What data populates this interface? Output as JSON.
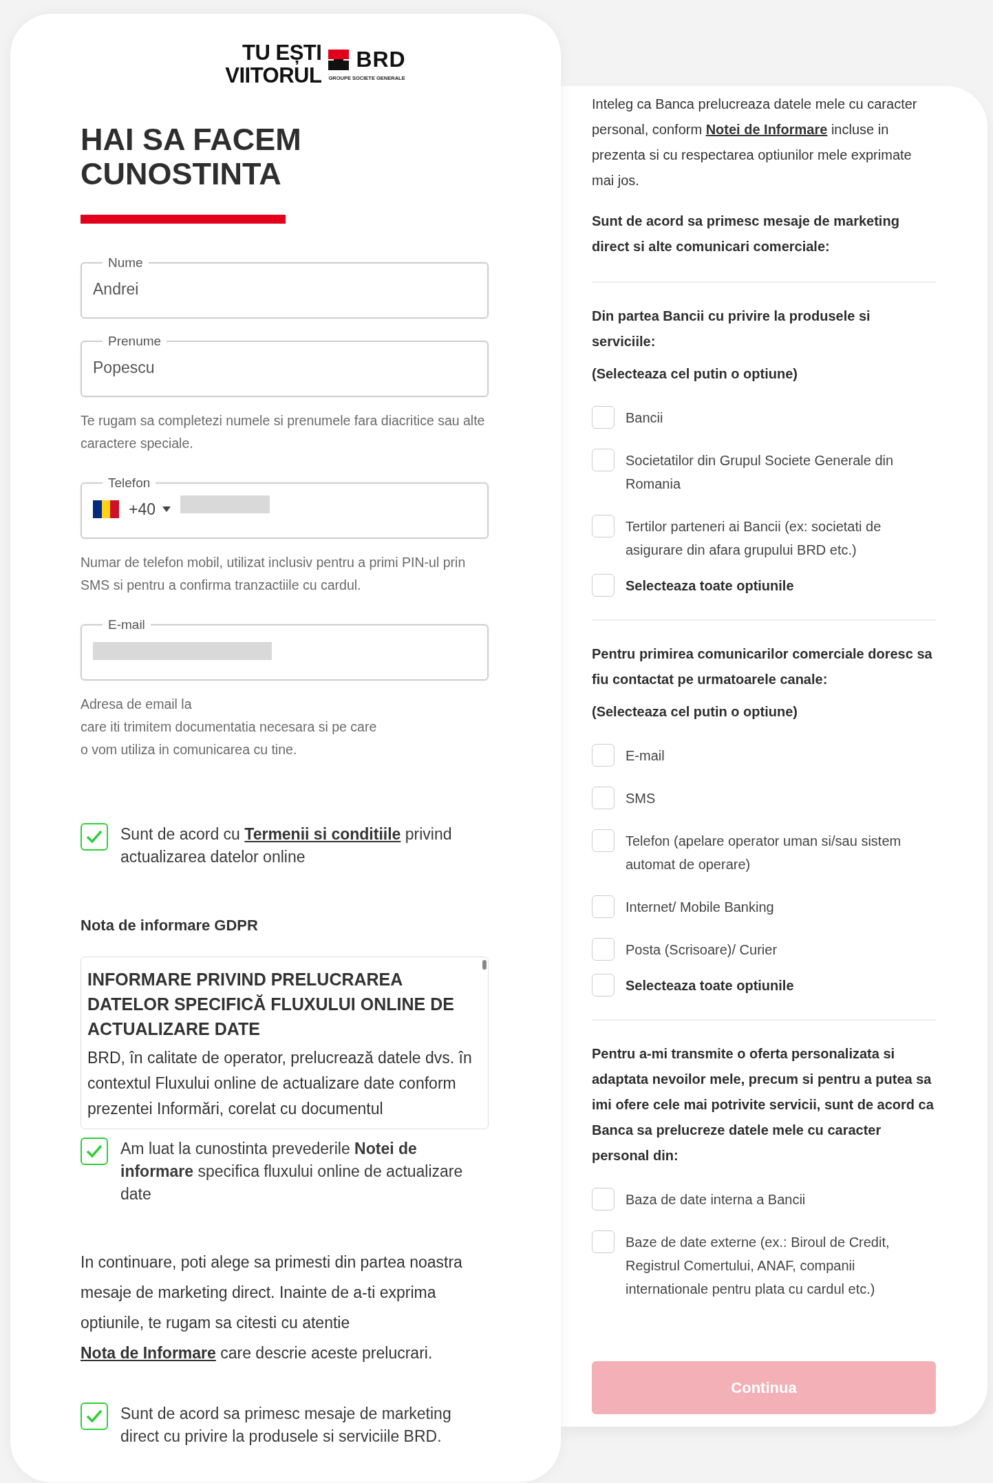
{
  "logo": {
    "tagline": [
      "TU EȘTI",
      "VIITORUL"
    ],
    "brand": "BRD",
    "group": "GROUPE SOCIETE GENERALE"
  },
  "left": {
    "heading": "HAI SA FACEM CUNOSTINTA",
    "fields": [
      {
        "kind": "text",
        "label": "Nume",
        "value": "Andrei"
      },
      {
        "kind": "text",
        "label": "Prenume",
        "value": "Popescu",
        "hint": "Te rugam sa completezi numele si prenumele fara diacritice sau alte caractere speciale."
      },
      {
        "kind": "phone",
        "label": "Telefon",
        "code": "+40",
        "redacted": true,
        "hint": "Numar de telefon mobil, utilizat inclusiv pentru a primi PIN-ul prin SMS si pentru a confirma tranzactiile cu cardul."
      },
      {
        "kind": "email",
        "label": "E-mail",
        "redacted": true,
        "hint": "Adresa de email la\ncare iti trimitem documentatia necesara si pe care\no vom utiliza in comunicarea cu tine."
      }
    ],
    "terms": {
      "checked": true,
      "before": "Sunt de acord cu ",
      "link": "Termenii si conditiile",
      "after": " privind actualizarea datelor online"
    },
    "gdpr_title": "Nota de informare GDPR",
    "gdpr_box": {
      "title": "INFORMARE PRIVIND PRELUCRAREA DATELOR SPECIFICĂ FLUXULUI ONLINE DE ACTUALIZARE DATE",
      "body": "BRD, în calitate de operator, prelucrează datele dvs. în contextul Fluxului online de actualizare date conform prezentei Informări, corelat cu documentul"
    },
    "gdpr_ack": {
      "checked": true,
      "text": "Am luat la cunostinta prevederile **Notei de informare** specifica fluxului online de actualizare date"
    },
    "intro": {
      "before": "In continuare, poti alege sa primesti din partea noastra mesaje de marketing direct. Inainte de a-ti exprima optiunile, te rugam sa citesti cu atentie ",
      "link": "Nota de Informare",
      "after": " care descrie aceste prelucrari."
    },
    "marketing": {
      "checked": true,
      "text": "Sunt de acord sa primesc mesaje de marketing direct cu privire la produsele si serviciile BRD."
    }
  },
  "right": {
    "intro": {
      "before": "Inteleg ca Banca prelucreaza datele mele cu caracter personal, conform ",
      "link": "Notei de Informare",
      "after": " incluse in prezenta si cu respectarea optiunilor mele exprimate mai jos."
    },
    "consent_title": "Sunt de acord sa primesc mesaje de marketing direct si alte comunicari comerciale:",
    "groups": [
      {
        "title": "Din partea Bancii cu privire la produsele si serviciile:",
        "subtitle": "(Selecteaza cel putin o optiune)",
        "options": [
          {
            "kind": "option",
            "label": "Bancii",
            "checked": false
          },
          {
            "kind": "option",
            "label": "Societatilor din Grupul Societe Generale din Romania",
            "checked": false
          },
          {
            "kind": "option",
            "label": "Tertilor parteneri ai Bancii (ex: societati de asigurare din afara grupului BRD etc.)",
            "checked": false
          },
          {
            "kind": "select_all",
            "label": "Selecteaza toate optiunile",
            "checked": false
          }
        ]
      },
      {
        "title": "Pentru primirea comunicarilor comerciale doresc sa fiu contactat pe urmatoarele canale:",
        "subtitle": "(Selecteaza cel putin o optiune)",
        "options": [
          {
            "kind": "option",
            "label": "E-mail",
            "checked": false
          },
          {
            "kind": "option",
            "label": "SMS",
            "checked": false
          },
          {
            "kind": "option",
            "label": "Telefon (apelare operator uman si/sau sistem automat de operare)",
            "checked": false
          },
          {
            "kind": "option",
            "label": "Internet/ Mobile Banking",
            "checked": false
          },
          {
            "kind": "option",
            "label": "Posta (Scrisoare)/ Curier",
            "checked": false
          },
          {
            "kind": "select_all",
            "label": "Selecteaza toate optiunile",
            "checked": false
          }
        ]
      },
      {
        "title": "Pentru a-mi transmite o oferta personalizata si adaptata nevoilor mele, precum si pentru a putea sa imi ofere cele mai potrivite servicii, sunt de acord ca Banca sa prelucreze datele mele cu caracter personal din:",
        "options": [
          {
            "kind": "option",
            "label": "Baza de date interna a Bancii",
            "checked": false
          },
          {
            "kind": "option",
            "label": "Baze de date externe (ex.: Biroul de Credit, Registrul Comertului, ANAF, companii internationale pentru plata cu cardul etc.)",
            "checked": false
          }
        ]
      }
    ],
    "button": {
      "label": "Continua",
      "disabled": true
    }
  }
}
